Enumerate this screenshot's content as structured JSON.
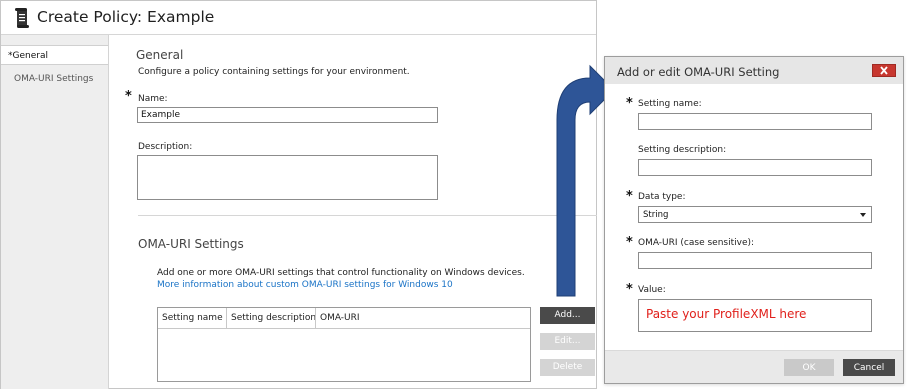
{
  "window": {
    "title": "Create Policy: Example"
  },
  "sidebar": {
    "items": [
      {
        "label": "*General",
        "selected": true
      },
      {
        "label": "OMA-URI Settings",
        "selected": false
      }
    ]
  },
  "general": {
    "heading": "General",
    "description": "Configure a policy containing settings for your environment.",
    "name_label": "Name:",
    "name_value": "Example",
    "description_label": "Description:",
    "description_value": ""
  },
  "oma": {
    "heading": "OMA-URI Settings",
    "description": "Add one or more OMA-URI settings that control functionality on Windows devices.",
    "link_text": "More information about custom OMA-URI settings for Windows 10",
    "table_columns": [
      "Setting name",
      "Setting description",
      "OMA-URI"
    ],
    "buttons": {
      "add": "Add...",
      "edit": "Edit...",
      "delete": "Delete"
    }
  },
  "dialog": {
    "title": "Add or edit OMA-URI Setting",
    "fields": {
      "setting_name_label": "Setting name:",
      "setting_description_label": "Setting description:",
      "data_type_label": "Data type:",
      "data_type_value": "String",
      "oma_uri_label": "OMA-URI (case sensitive):",
      "value_label": "Value:",
      "value_text": "Paste your ProfileXML here"
    },
    "buttons": {
      "ok": "OK",
      "cancel": "Cancel"
    }
  },
  "colors": {
    "arrow": "#2e5597",
    "close_button": "#c7372f",
    "link": "#1a73c6",
    "annotation_text": "#e0201b",
    "primary_button": "#4a4a4a"
  },
  "icons": {
    "policy": "scroll-document-icon",
    "close": "close-icon",
    "dropdown": "chevron-down-icon",
    "flow": "curved-arrow-icon"
  }
}
